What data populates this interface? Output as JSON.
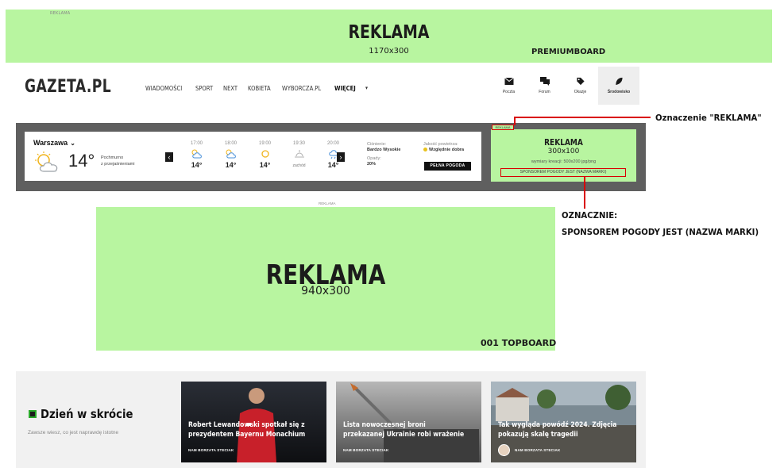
{
  "premiumboard": {
    "tiny_label": "REKLAMA",
    "title": "REKLAMA",
    "size": "1170x300",
    "slot": "PREMIUMBOARD"
  },
  "header": {
    "logo": "GAZETA.PL",
    "nav": [
      "WIADOMOŚCI",
      "SPORT",
      "NEXT",
      "KOBIETA",
      "WYBORCZA.PL"
    ],
    "nav_more": "WIĘCEJ",
    "icons": [
      {
        "icon": "mail-icon",
        "label": "Poczta"
      },
      {
        "icon": "forum-icon",
        "label": "Forum"
      },
      {
        "icon": "tag-icon",
        "label": "Okazje"
      },
      {
        "icon": "leaf-icon",
        "label": "Środowisko"
      }
    ]
  },
  "weather": {
    "city": "Warszawa",
    "temp": "14°",
    "desc_line1": "Pochmurno",
    "desc_line2": "z przejaśnieniami",
    "hours": [
      {
        "time": "17:00",
        "temp": "14°",
        "icon": "cloud-icon"
      },
      {
        "time": "18:00",
        "temp": "14°",
        "icon": "cloud-icon"
      },
      {
        "time": "19:00",
        "temp": "14°",
        "icon": "sun-icon"
      },
      {
        "time": "19:30",
        "temp": "zachód",
        "icon": "sunset-icon"
      },
      {
        "time": "20:00",
        "temp": "14°",
        "icon": "rain-icon"
      }
    ],
    "pressure_label": "Ciśnienie:",
    "pressure_value": "Bardzo Wysokie",
    "precip_label": "Opady:",
    "precip_value": "20%",
    "air_label": "Jakość powietrza:",
    "air_value": "Względnie dobra",
    "button": "PEŁNA POGODA"
  },
  "weather_ad": {
    "mark": "REKLAMA",
    "title": "REKLAMA",
    "size": "300x100",
    "note": "wymiary kreacji: 500x200 jpg/png",
    "sponsor": "SPONSOREM POGODY JEST (NAZWA MARKI)"
  },
  "annotations": {
    "reklama": "Oznaczenie \"REKLAMA\"",
    "sponsor_line1": "OZNACZNIE:",
    "sponsor_line2": "SPONSOREM POGODY JEST (NAZWA MARKI)"
  },
  "topboard": {
    "tiny_label": "REKLAMA",
    "title": "REKLAMA",
    "size": "940x300",
    "slot": "001 TOPBOARD"
  },
  "dzien": {
    "title": "Dzień w skrócie",
    "subtitle": "Zawsze wiesz, co jest naprawdę istotne",
    "cards": [
      {
        "title": "Robert Lewandowski spotkał się z prezydentem Bayernu Monachium",
        "author": "NAM BORZATA STECIAK"
      },
      {
        "title": "Lista nowoczesnej broni przekazanej Ukrainie robi wrażenie",
        "author": "NAM BORZATA STECIAK"
      },
      {
        "title": "Tak wygląda powódź 2024. Zdjęcia pokazują skalę tragedii",
        "author": "NAM BORZATA STECIAK"
      }
    ]
  },
  "colors": {
    "ad_green": "#b8f5a0",
    "annotation_red": "#d90000",
    "band_gray": "#5f5f5f"
  }
}
